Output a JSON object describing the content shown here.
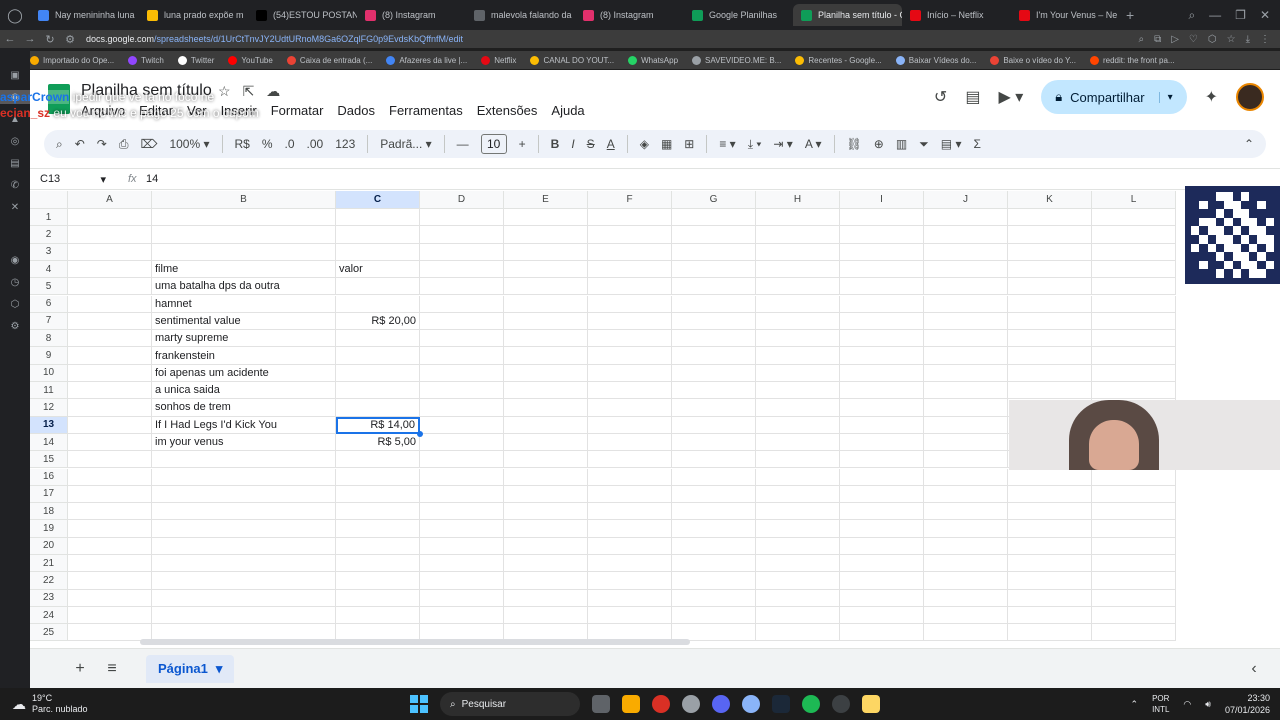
{
  "browser": {
    "tabs": [
      {
        "label": "Nay menininha luna",
        "color": "#4285f4"
      },
      {
        "label": "luna prado expõe m",
        "color": "#fbbc04"
      },
      {
        "label": "(54)ESTOU POSTAN",
        "color": "#000000"
      },
      {
        "label": "(8) Instagram",
        "color": "#e1306c"
      },
      {
        "label": "malevola falando da",
        "color": "#5f6368"
      },
      {
        "label": "(8) Instagram",
        "color": "#e1306c"
      },
      {
        "label": "Google Planilhas",
        "color": "#0f9d58"
      },
      {
        "label": "Planilha sem título - Goo",
        "color": "#0f9d58",
        "active": true
      },
      {
        "label": "Início – Netflix",
        "color": "#e50914"
      },
      {
        "label": "I'm Your Venus – Ne",
        "color": "#e50914"
      }
    ],
    "url_host": "docs.google.com",
    "url_path": "/spreadsheets/d/1UrCtTnvJY2UdtURnoM8Ga6OZqlFG0p9EvdsKbQffnfM/edit",
    "bookmarks": [
      {
        "label": "Importado do Ope...",
        "color": "#f9ab00"
      },
      {
        "label": "Twitch",
        "color": "#9146ff"
      },
      {
        "label": "Twitter",
        "color": "#ffffff"
      },
      {
        "label": "YouTube",
        "color": "#ff0000"
      },
      {
        "label": "Caixa de entrada (...",
        "color": "#ea4335"
      },
      {
        "label": "Afazeres da live |...",
        "color": "#4285f4"
      },
      {
        "label": "Netflix",
        "color": "#e50914"
      },
      {
        "label": "CANAL DO YOUT...",
        "color": "#fbbc04"
      },
      {
        "label": "WhatsApp",
        "color": "#25d366"
      },
      {
        "label": "SAVEVIDEO.ME: B...",
        "color": "#9aa0a6"
      },
      {
        "label": "Recentes - Google...",
        "color": "#fbbc04"
      },
      {
        "label": "Baixar Vídeos do...",
        "color": "#8ab4f8"
      },
      {
        "label": "Baixe o vídeo do Y...",
        "color": "#ea4335"
      },
      {
        "label": "reddit: the front pa...",
        "color": "#ff4500"
      }
    ]
  },
  "sheets": {
    "doc_title": "Planilha sem título",
    "menu": [
      "Arquivo",
      "Editar",
      "Ver",
      "Inserir",
      "Formatar",
      "Dados",
      "Ferramentas",
      "Extensões",
      "Ajuda"
    ],
    "share_label": "Compartilhar",
    "toolbar": {
      "zoom": "100%",
      "currency": "R$",
      "percent": "%",
      "dec_down": ".0",
      "dec_up": ".00",
      "format_123": "123",
      "font": "Padrã...",
      "font_size": "10"
    },
    "namebox": "C13",
    "formula_value": "14",
    "columns": [
      "A",
      "B",
      "C",
      "D",
      "E",
      "F",
      "G",
      "H",
      "I",
      "J",
      "K",
      "L"
    ],
    "selected_column": "C",
    "selected_row": 13,
    "row_count": 25,
    "cells": [
      {
        "row": 4,
        "col": "B",
        "value": "filme",
        "align": "left"
      },
      {
        "row": 4,
        "col": "C",
        "value": "valor",
        "align": "left"
      },
      {
        "row": 5,
        "col": "B",
        "value": "uma batalha dps da outra",
        "align": "left"
      },
      {
        "row": 6,
        "col": "B",
        "value": "hamnet",
        "align": "left"
      },
      {
        "row": 7,
        "col": "B",
        "value": "sentimental value",
        "align": "left"
      },
      {
        "row": 7,
        "col": "C",
        "value": "R$ 20,00",
        "align": "right"
      },
      {
        "row": 8,
        "col": "B",
        "value": "marty supreme",
        "align": "left"
      },
      {
        "row": 9,
        "col": "B",
        "value": "frankenstein",
        "align": "left"
      },
      {
        "row": 10,
        "col": "B",
        "value": "foi apenas um acidente",
        "align": "left"
      },
      {
        "row": 11,
        "col": "B",
        "value": "a unica saida",
        "align": "left"
      },
      {
        "row": 12,
        "col": "B",
        "value": "sonhos de trem",
        "align": "left"
      },
      {
        "row": 13,
        "col": "B",
        "value": "If I Had Legs I'd Kick You",
        "align": "left"
      },
      {
        "row": 13,
        "col": "C",
        "value": "R$ 14,00",
        "align": "right",
        "selected": true
      },
      {
        "row": 14,
        "col": "B",
        "value": "im your venus",
        "align": "left"
      },
      {
        "row": 14,
        "col": "C",
        "value": "R$ 5,00",
        "align": "right"
      }
    ],
    "sheet_tab": "Página1"
  },
  "overlay": {
    "line1": "asparCrown",
    "line1b": "ipedir que ve ta no foco ne",
    "line2": "ecian_sz",
    "line2b": "eu vou no wic e pago 25 com o cupom"
  },
  "taskbar": {
    "temperature": "19°C",
    "weather": "Parc. nublado",
    "search": "Pesquisar",
    "lang_top": "POR",
    "lang_bottom": "INTL",
    "time": "23:30",
    "date": "07/01/2026"
  }
}
